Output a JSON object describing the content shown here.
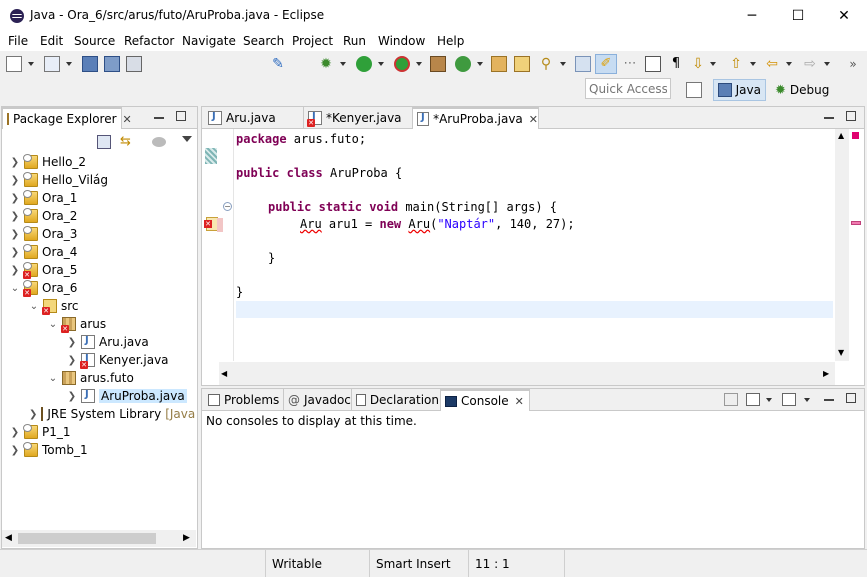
{
  "window": {
    "title": "Java - Ora_6/src/arus/futo/AruProba.java - Eclipse",
    "minimize": "─",
    "maximize": "☐",
    "close": "✕"
  },
  "menu": [
    "File",
    "Edit",
    "Source",
    "Refactor",
    "Navigate",
    "Search",
    "Project",
    "Run",
    "Window",
    "Help"
  ],
  "toolbar": {
    "quick_access_placeholder": "Quick Access",
    "perspectives": {
      "java": "Java",
      "debug": "Debug"
    }
  },
  "package_explorer": {
    "title": "Package Explorer",
    "close": "✕",
    "items": [
      {
        "label": "Hello_2",
        "expanded": false,
        "icon": "project-icon",
        "error": false
      },
      {
        "label": "Hello_Világ",
        "expanded": false,
        "icon": "project-icon",
        "error": false
      },
      {
        "label": "Ora_1",
        "expanded": false,
        "icon": "project-icon",
        "error": false
      },
      {
        "label": "Ora_2",
        "expanded": false,
        "icon": "project-icon",
        "error": false
      },
      {
        "label": "Ora_3",
        "expanded": false,
        "icon": "project-icon",
        "error": false
      },
      {
        "label": "Ora_4",
        "expanded": false,
        "icon": "project-icon",
        "error": false
      },
      {
        "label": "Ora_5",
        "expanded": false,
        "icon": "project-icon",
        "error": true
      },
      {
        "label": "Ora_6",
        "expanded": true,
        "icon": "project-icon",
        "error": true
      },
      {
        "label": "src",
        "expanded": true,
        "icon": "source-folder-icon",
        "error": true
      },
      {
        "label": "arus",
        "expanded": true,
        "icon": "package-icon",
        "error": true
      },
      {
        "label": "Aru.java",
        "expanded": false,
        "icon": "java-file-icon",
        "error": false
      },
      {
        "label": "Kenyer.java",
        "expanded": false,
        "icon": "java-file-icon",
        "error": true
      },
      {
        "label": "arus.futo",
        "expanded": true,
        "icon": "package-icon",
        "error": false
      },
      {
        "label": "AruProba.java",
        "expanded": false,
        "icon": "java-file-icon",
        "error": false
      },
      {
        "label": "JRE System Library",
        "suffix": "[JavaS",
        "expanded": false,
        "icon": "library-icon",
        "error": false
      },
      {
        "label": "P1_1",
        "expanded": false,
        "icon": "project-icon",
        "error": false
      },
      {
        "label": "Tomb_1",
        "expanded": false,
        "icon": "project-icon",
        "error": false
      }
    ]
  },
  "editor": {
    "tabs": [
      {
        "label": "Aru.java",
        "active": false,
        "error": false
      },
      {
        "label": "*Kenyer.java",
        "active": false,
        "error": true
      },
      {
        "label": "*AruProba.java",
        "active": true,
        "error": false
      }
    ],
    "close": "✕",
    "code": {
      "line1_kw": "package",
      "line1_rest": " arus.futo;",
      "line3_kw1": "public",
      "line3_kw2": "class",
      "line3_rest": " AruProba {",
      "line5_kw1": "public",
      "line5_kw2": "static",
      "line5_kw3": "void",
      "line5_rest": " main(String[] args) {",
      "line6_type": "Aru",
      "line6_mid": " aru1 = ",
      "line6_new": "new",
      "line6_ctor": "Aru",
      "line6_paren": "(",
      "line6_str": "\"Naptár\"",
      "line6_tail": ", 140, 27);",
      "line8": "}",
      "line10": "}"
    }
  },
  "bottom_panel": {
    "tabs": [
      {
        "label": "Problems",
        "active": false
      },
      {
        "label": "Javadoc",
        "active": false
      },
      {
        "label": "Declaration",
        "active": false
      },
      {
        "label": "Console",
        "active": true
      }
    ],
    "close": "✕",
    "message": "No consoles to display at this time."
  },
  "status": {
    "mode": "Writable",
    "insert": "Smart Insert",
    "position": "11 : 1"
  },
  "colors": {
    "keyword": "#7f0055",
    "string": "#2a00ff",
    "selection": "#cce8ff",
    "current_line": "#e8f2fe",
    "error": "#dd2222"
  }
}
